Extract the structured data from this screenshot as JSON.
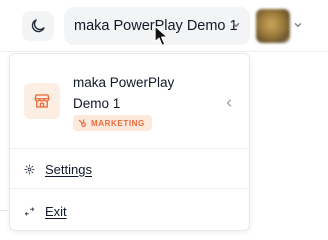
{
  "topbar": {
    "theme_toggle_icon": "moon-icon",
    "workspace_selector": {
      "label": "maka PowerPlay Demo 1",
      "chevron_icon": "chevron-down-icon"
    },
    "avatar_icon": "user-avatar",
    "avatar_chevron_icon": "chevron-down-icon"
  },
  "dropdown": {
    "workspace": {
      "icon": "storefront-icon",
      "name": "maka PowerPlay Demo 1",
      "badge": {
        "icon": "hubspot-icon",
        "label": "MARKETING",
        "color": "#ea6b3a",
        "background": "#fde8dc"
      },
      "collapse_icon": "chevron-left-icon"
    },
    "menu": [
      {
        "label": "Settings",
        "icon": "gear-icon"
      },
      {
        "label": "Exit",
        "icon": "exit-arrows-icon"
      }
    ]
  },
  "colors": {
    "accent": "#ea6b3a",
    "button_bg": "#f3f4f6",
    "border": "#e6e8eb"
  }
}
